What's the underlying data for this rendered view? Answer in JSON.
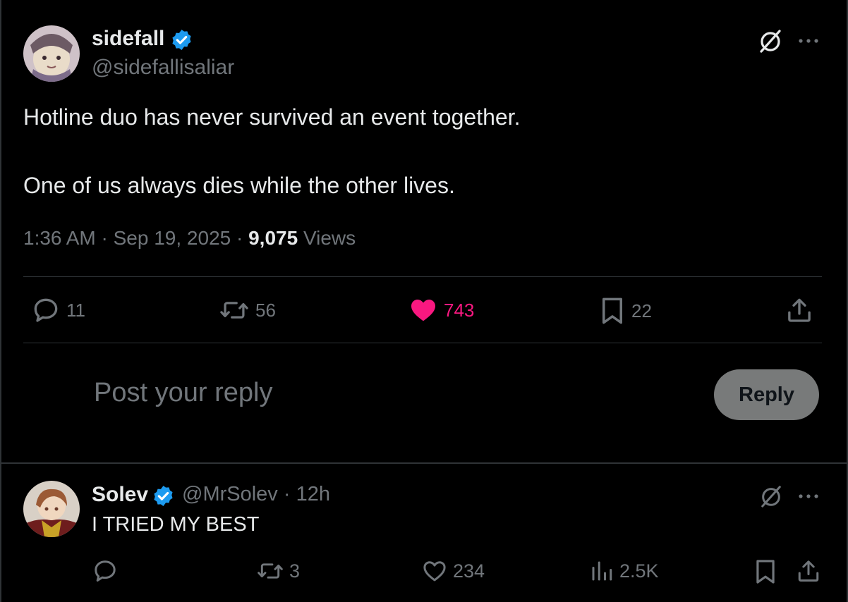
{
  "colors": {
    "background": "#000000",
    "text_primary": "#e7e9ea",
    "text_secondary": "#71767b",
    "like_accent": "#f91880",
    "verified_badge": "#1d9bf0",
    "divider": "#2f3336",
    "reply_button_bg": "#787a7a"
  },
  "main_post": {
    "author": {
      "display_name": "sidefall",
      "handle": "@sidefallisaliar",
      "verified": true,
      "avatar_icon": "anime-avatar"
    },
    "text_lines": [
      "Hotline duo has never survived an event together.",
      "One of us always dies while the other lives."
    ],
    "meta": {
      "time": "1:36 AM",
      "separator": " · ",
      "date": "Sep 19, 2025",
      "views_count": "9,075",
      "views_label": " Views"
    },
    "actions": {
      "reply": {
        "icon": "reply-icon",
        "count": "11"
      },
      "repost": {
        "icon": "repost-icon",
        "count": "56"
      },
      "like": {
        "icon": "heart-filled-icon",
        "count": "743",
        "liked": true
      },
      "bookmark": {
        "icon": "bookmark-icon",
        "count": "22"
      },
      "share": {
        "icon": "share-icon"
      }
    },
    "top_icons": [
      "grok-icon",
      "more-icon"
    ]
  },
  "reply_composer": {
    "placeholder": "Post your reply",
    "button_label": "Reply"
  },
  "reply_post": {
    "author": {
      "display_name": "Solev",
      "handle": "@MrSolev",
      "time": "· 12h",
      "verified": true,
      "avatar_icon": "anime-avatar"
    },
    "text": "I TRIED MY BEST",
    "actions": {
      "reply": {
        "icon": "reply-icon",
        "count": ""
      },
      "repost": {
        "icon": "repost-icon",
        "count": "3"
      },
      "like": {
        "icon": "heart-outline-icon",
        "count": "234"
      },
      "views": {
        "icon": "views-bar-chart-icon",
        "count": "2.5K"
      },
      "bookmark": {
        "icon": "bookmark-icon"
      },
      "share": {
        "icon": "share-icon"
      }
    },
    "top_icons": [
      "grok-icon",
      "more-icon"
    ]
  }
}
